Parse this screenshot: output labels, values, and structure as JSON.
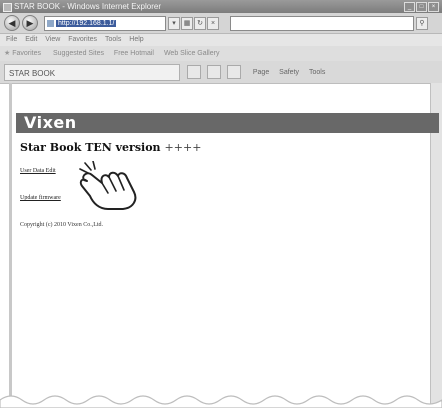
{
  "window": {
    "title": "STAR BOOK - Windows Internet Explorer",
    "controls": [
      "_",
      "□",
      "×"
    ]
  },
  "address_bar": {
    "url": "http://192.168.1.1/"
  },
  "menu": [
    "File",
    "Edit",
    "View",
    "Favorites",
    "Tools",
    "Help"
  ],
  "favorites_bar": {
    "favorites_label": "Favorites",
    "items": [
      "Suggested Sites",
      "Free Hotmail",
      "Web Slice Gallery"
    ]
  },
  "tab": {
    "label": "STAR BOOK"
  },
  "tab_tools": [
    "Page",
    "Safety",
    "Tools"
  ],
  "page": {
    "brand": "Vixen",
    "heading": "Star Book TEN version",
    "version": "++++",
    "links": [
      {
        "label": "User Data Edit"
      },
      {
        "label": "Update firmware"
      }
    ],
    "copyright": "Copyright (c) 2010 Vixen Co.,Ltd."
  },
  "colors": {
    "brand_bar": "#686868",
    "brand_text": "#ffffff"
  },
  "icons": [
    "pointing-hand-cursor-icon",
    "back-icon",
    "forward-icon",
    "refresh-icon",
    "stop-icon",
    "favorites-star-icon"
  ]
}
